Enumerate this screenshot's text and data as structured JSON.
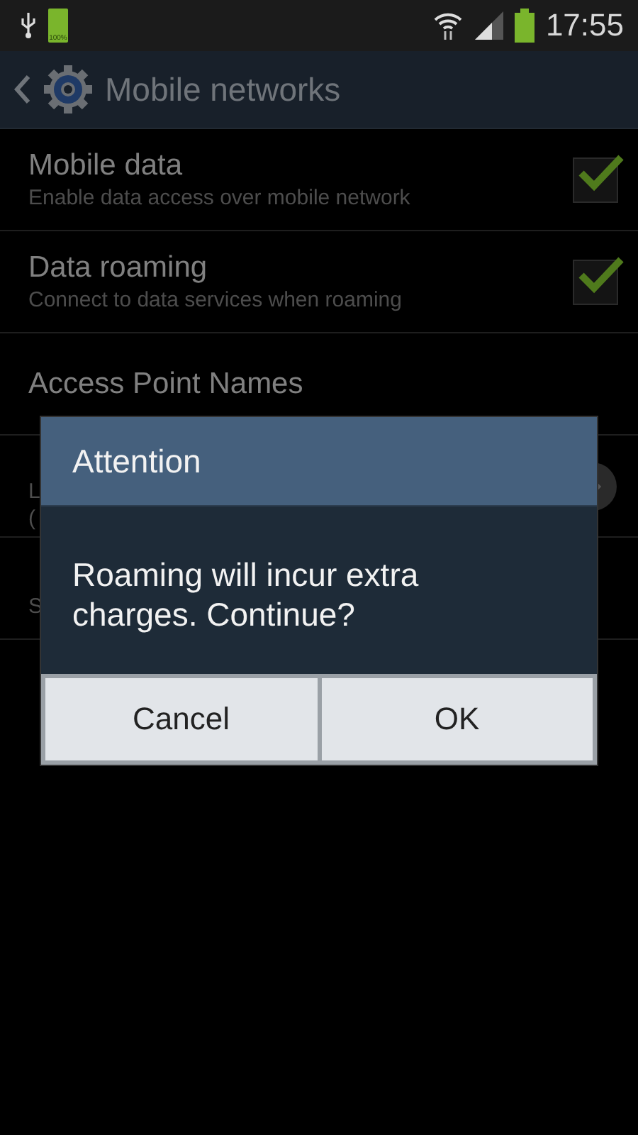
{
  "status_bar": {
    "battery_notice": "100%",
    "time": "17:55"
  },
  "action_bar": {
    "title": "Mobile networks"
  },
  "settings": [
    {
      "kind": "checkbox",
      "title": "Mobile data",
      "summary": [
        "Enable data access over mobile network"
      ],
      "checked": true
    },
    {
      "kind": "checkbox",
      "title": "Data roaming",
      "summary": [
        "Connect to data services when roaming"
      ],
      "checked": true
    },
    {
      "kind": "plain",
      "title": "Access Point Names"
    },
    {
      "kind": "arrow",
      "summary": [
        "L",
        "("
      ]
    },
    {
      "kind": "plain",
      "summary": [
        "S"
      ]
    }
  ],
  "dialog": {
    "title": "Attention",
    "message": "Roaming will incur extra charges. Continue?",
    "buttons": [
      "Cancel",
      "OK"
    ]
  }
}
